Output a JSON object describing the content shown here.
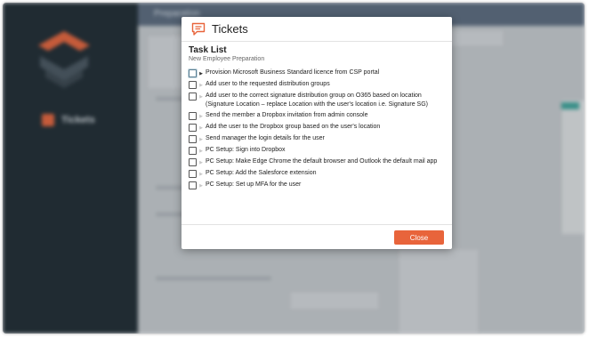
{
  "app": {
    "sidebar_label": "Tickets",
    "topbar_label": "Preparation"
  },
  "modal": {
    "title": "Tickets",
    "close_label": "Close",
    "accent_color": "#e8643b"
  },
  "task_list": {
    "title": "Task List",
    "subtitle": "New Employee Preparation",
    "tasks": [
      {
        "label": "Provision Microsoft Business Standard licence from CSP portal"
      },
      {
        "label": "Add user to the requested distribution groups"
      },
      {
        "label": "Add user to the correct signature distribution group on O365 based on location (Signature Location – replace Location with the user's location i.e. Signature SG)"
      },
      {
        "label": "Send the member a Dropbox invitation from admin console"
      },
      {
        "label": "Add the user to the Dropbox group based on the user's location"
      },
      {
        "label": "Send manager the login details for the user"
      },
      {
        "label": "PC Setup: Sign into Dropbox"
      },
      {
        "label": "PC Setup: Make Edge Chrome the default browser and Outlook the default mail app"
      },
      {
        "label": "PC Setup: Add the Salesforce extension"
      },
      {
        "label": "PC Setup: Set up MFA for the user"
      }
    ]
  }
}
